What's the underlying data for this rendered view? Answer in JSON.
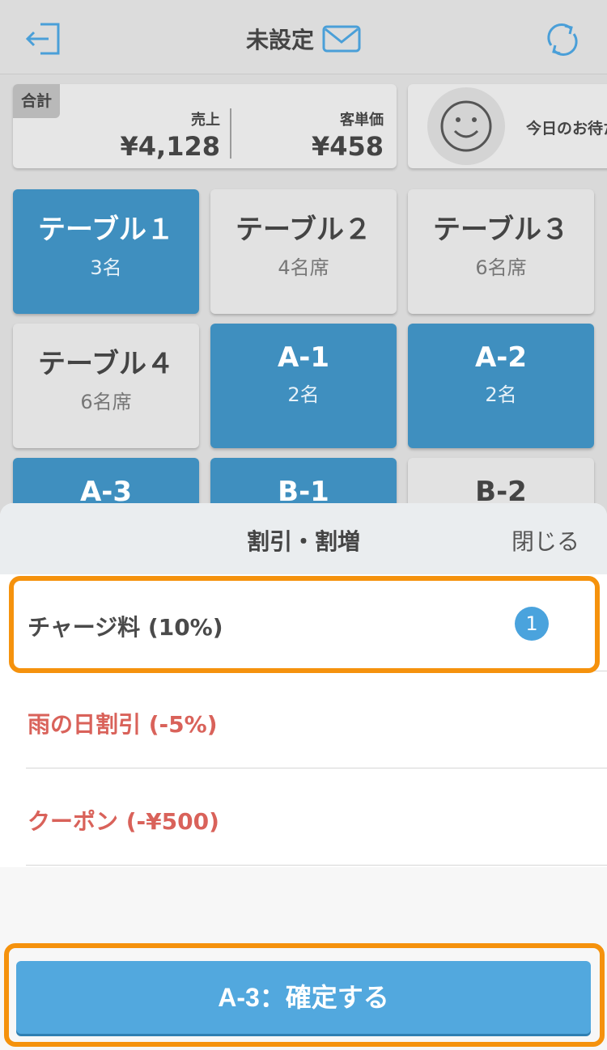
{
  "header": {
    "title": "未設定",
    "icons": {
      "logout": "logout-icon",
      "mail": "mail-icon",
      "refresh": "refresh-icon"
    },
    "accent_color": "#4a9fd8"
  },
  "summary": {
    "tag": "合計",
    "sales_label": "売上",
    "sales_value": "¥4,128",
    "unit_price_label": "客単価",
    "unit_price_value": "¥458"
  },
  "waiting": {
    "label": "今日のお待た",
    "icon": "smile-icon"
  },
  "tables": [
    {
      "name": "テーブル１",
      "sub": "3名",
      "occupied": true
    },
    {
      "name": "テーブル２",
      "sub": "4名席",
      "occupied": false
    },
    {
      "name": "テーブル３",
      "sub": "6名席",
      "occupied": false
    },
    {
      "name": "テーブル４",
      "sub": "6名席",
      "occupied": false
    },
    {
      "name": "A-1",
      "sub": "2名",
      "occupied": true
    },
    {
      "name": "A-2",
      "sub": "2名",
      "occupied": true
    },
    {
      "name": "A-3",
      "sub": "",
      "occupied": true
    },
    {
      "name": "B-1",
      "sub": "",
      "occupied": true
    },
    {
      "name": "B-2",
      "sub": "",
      "occupied": false
    }
  ],
  "sheet": {
    "title": "割引・割増",
    "close_label": "閉じる",
    "items": [
      {
        "label": "チャージ料 (10%)",
        "kind": "surcharge",
        "count": "1"
      },
      {
        "label": "雨の日割引 (-5%)",
        "kind": "discount"
      },
      {
        "label": "クーポン (-¥500)",
        "kind": "discount"
      }
    ],
    "confirm_label": "A-3：確定する"
  },
  "colors": {
    "occupied_tile": "#3f8fbf",
    "free_tile": "#e2e2e2",
    "discount_text": "#d9625a",
    "highlight": "#f5920d",
    "confirm_button": "#52a8de"
  }
}
